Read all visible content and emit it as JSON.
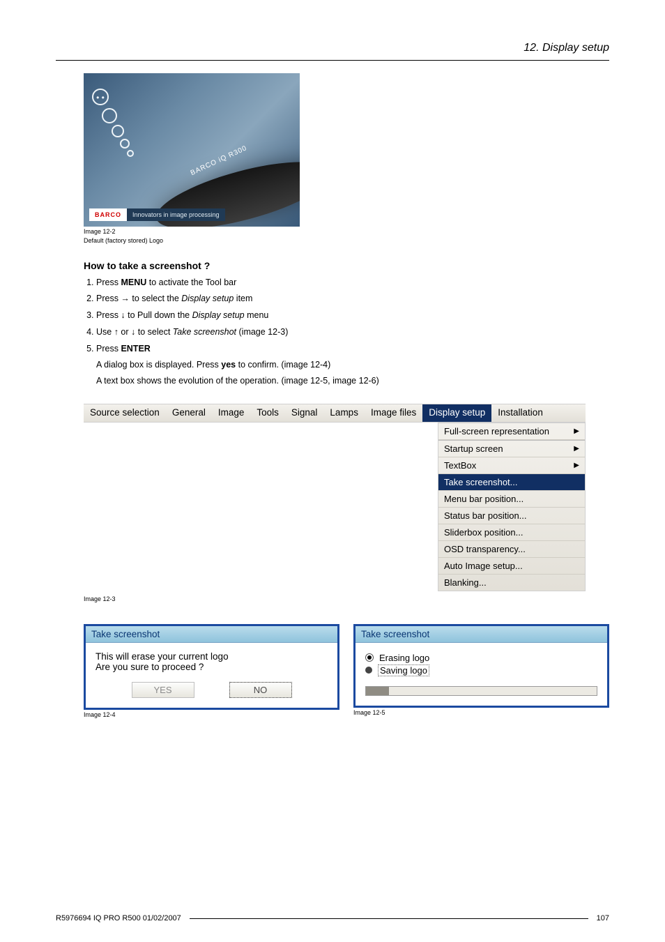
{
  "header": {
    "section": "12.  Display setup"
  },
  "figure_logo": {
    "brand": "BARCO",
    "slogan": "Innovators in image processing",
    "ribbon": "BARCO iQ R300",
    "caption_line1": "Image 12-2",
    "caption_line2": "Default (factory stored) Logo"
  },
  "subheading": "How to take a screenshot ?",
  "steps": {
    "s1_a": "Press ",
    "s1_b": "MENU",
    "s1_c": " to activate the Tool bar",
    "s2_a": "Press → to select the ",
    "s2_b": "Display setup",
    "s2_c": " item",
    "s3_a": "Press ↓ to Pull down the ",
    "s3_b": "Display setup",
    "s3_c": " menu",
    "s4_a": "Use ↑ or ↓ to select ",
    "s4_b": "Take screenshot",
    "s4_c": " (image 12-3)",
    "s5_a": "Press ",
    "s5_b": "ENTER",
    "sub1_a": "A dialog box is displayed.  Press ",
    "sub1_b": "yes",
    "sub1_c": " to confirm.  (image 12-4)",
    "sub2": "A text box shows the evolution of the operation.  (image 12-5, image 12-6)"
  },
  "menubar": {
    "items": [
      {
        "label": "Source selection"
      },
      {
        "label": "General"
      },
      {
        "label": "Image"
      },
      {
        "label": "Tools"
      },
      {
        "label": "Signal"
      },
      {
        "label": "Lamps"
      },
      {
        "label": "Image files"
      },
      {
        "label": "Display setup",
        "selected": true
      },
      {
        "label": "Installation"
      }
    ],
    "dropdown": [
      {
        "label": "Full-screen representation",
        "submenu": true
      },
      {
        "sep": true
      },
      {
        "label": "Startup screen",
        "submenu": true
      },
      {
        "label": "TextBox",
        "submenu": true
      },
      {
        "label": "Take screenshot...",
        "selected": true
      },
      {
        "label": "Menu bar position..."
      },
      {
        "label": "Status bar position..."
      },
      {
        "label": "Sliderbox position..."
      },
      {
        "label": "OSD transparency..."
      },
      {
        "label": "Auto Image setup..."
      },
      {
        "label": "Blanking..."
      }
    ],
    "caption": "Image 12-3"
  },
  "dialog_confirm": {
    "title": "Take screenshot",
    "line1": "This will erase your current logo",
    "line2": "Are you sure to proceed ?",
    "yes": "YES",
    "no": "NO",
    "caption": "Image 12-4"
  },
  "dialog_progress": {
    "title": "Take screenshot",
    "opt1": "Erasing logo",
    "opt2": "Saving logo",
    "caption": "Image 12-5"
  },
  "footer": {
    "left": "R5976694   IQ PRO R500   01/02/2007",
    "page": "107"
  }
}
